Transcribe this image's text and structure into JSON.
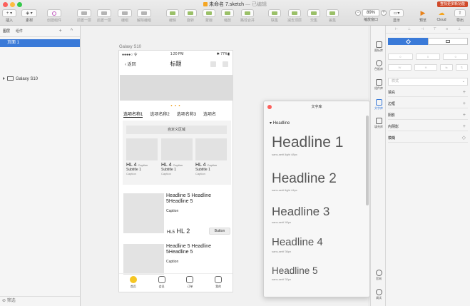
{
  "window": {
    "title": "未命名 7.sketch",
    "subtitle": " — 已编辑",
    "promo": "查找更多新功能"
  },
  "toolbar": {
    "insert": "插入",
    "symbols": "素材",
    "create_symbol": "创建组件",
    "forward": "前置一层",
    "backward": "后置一层",
    "group": "编组",
    "ungroup": "解除编组",
    "edit": "编辑",
    "rotate": "旋转",
    "mask": "蒙版",
    "scale": "缩放",
    "flatten": "路径合并",
    "union": "联集",
    "subtract": "减去顶层",
    "intersect": "交集",
    "difference": "差集",
    "zoom_value": "89%",
    "zoom_label": "缩放窗口",
    "view": "显示",
    "preview": "预览",
    "cloud": "Cloud",
    "export": "导出"
  },
  "left_panel": {
    "tab_layers": "图层",
    "tab_components": "组件",
    "page": "页面 1",
    "artboard": "Galaxy S10",
    "filter": "筛选"
  },
  "artboard": {
    "label": "Galaxy S10",
    "status_left": "●●●●○ 令",
    "status_time": "1:20 PM",
    "status_right": "✱ 77%▮",
    "nav_back": "返回",
    "nav_title": "标题",
    "tabs": [
      "选项名称1",
      "选项名称2",
      "选项名称3",
      "选项名"
    ],
    "custom_area": "自定义区域",
    "cards": [
      {
        "hl": "HL 4",
        "cap_inline": "Caption",
        "sub": "Subtitle 1",
        "cap": "Caption"
      },
      {
        "hl": "HL 4",
        "cap_inline": "Caption",
        "sub": "Subtitle 1",
        "cap": "Caption"
      },
      {
        "hl": "HL 4",
        "cap_inline": "Caption",
        "sub": "Subtitle 1",
        "cap": "Caption"
      }
    ],
    "list_item1": {
      "title": "Headline 5 Headline 5Headline 5",
      "caption": "Caption",
      "hl5_small": "HL5",
      "hl2": "HL 2",
      "button": "Button"
    },
    "list_item2": {
      "title": "Headline 5 Headline 5Headline 5",
      "caption": "Caption"
    },
    "tabbar": [
      "首页",
      "会员",
      "订单",
      "我的"
    ]
  },
  "library": {
    "title": "文字库",
    "section": "Headline",
    "items": [
      {
        "name": "Headline 1",
        "spec": "sans-serif-light 48px"
      },
      {
        "name": "Headline 2",
        "spec": "sans-serif-light 44px"
      },
      {
        "name": "Headline 3",
        "spec": "sans-serif 40px"
      },
      {
        "name": "Headline 4",
        "spec": "sans-serif 36px"
      },
      {
        "name": "Headline 5",
        "spec": "sans-serif 32px"
      }
    ]
  },
  "icon_strip": {
    "items": [
      "图标库",
      "色板库",
      "组件库",
      "文字库",
      "填充库"
    ],
    "bottom": [
      "官网",
      "调试"
    ]
  },
  "inspector": {
    "style_label": "样式",
    "fill": "填充",
    "border": "边框",
    "shadow": "阴影",
    "inner_shadow": "内阴影",
    "blur": "模糊",
    "field_placeholder": "0",
    "field_w": "W",
    "field_h": "H"
  },
  "colors": {
    "accent": "#3a7ad8",
    "close": "#fc605c"
  }
}
